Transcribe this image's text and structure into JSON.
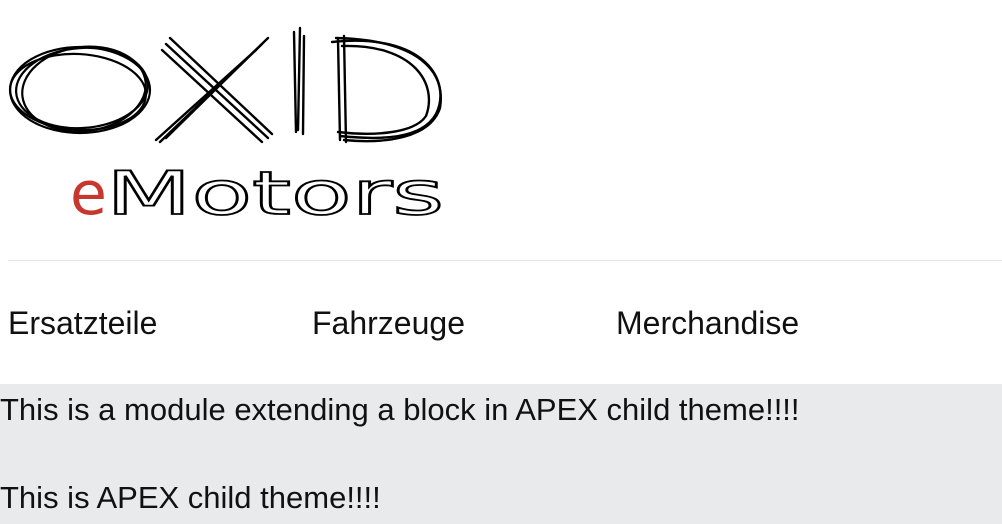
{
  "header": {
    "logo": {
      "brand_top": "OXID",
      "brand_prefix": "e",
      "brand_suffix": "Motors",
      "brand_color": "#000000",
      "accent_color": "#c8372d"
    }
  },
  "nav": {
    "items": [
      {
        "label": "Ersatzteile"
      },
      {
        "label": "Fahrzeuge"
      },
      {
        "label": "Merchandise"
      }
    ]
  },
  "notice": {
    "line1": "This is a module extending a block in APEX child theme!!!!",
    "line2": "This is APEX child theme!!!!"
  }
}
